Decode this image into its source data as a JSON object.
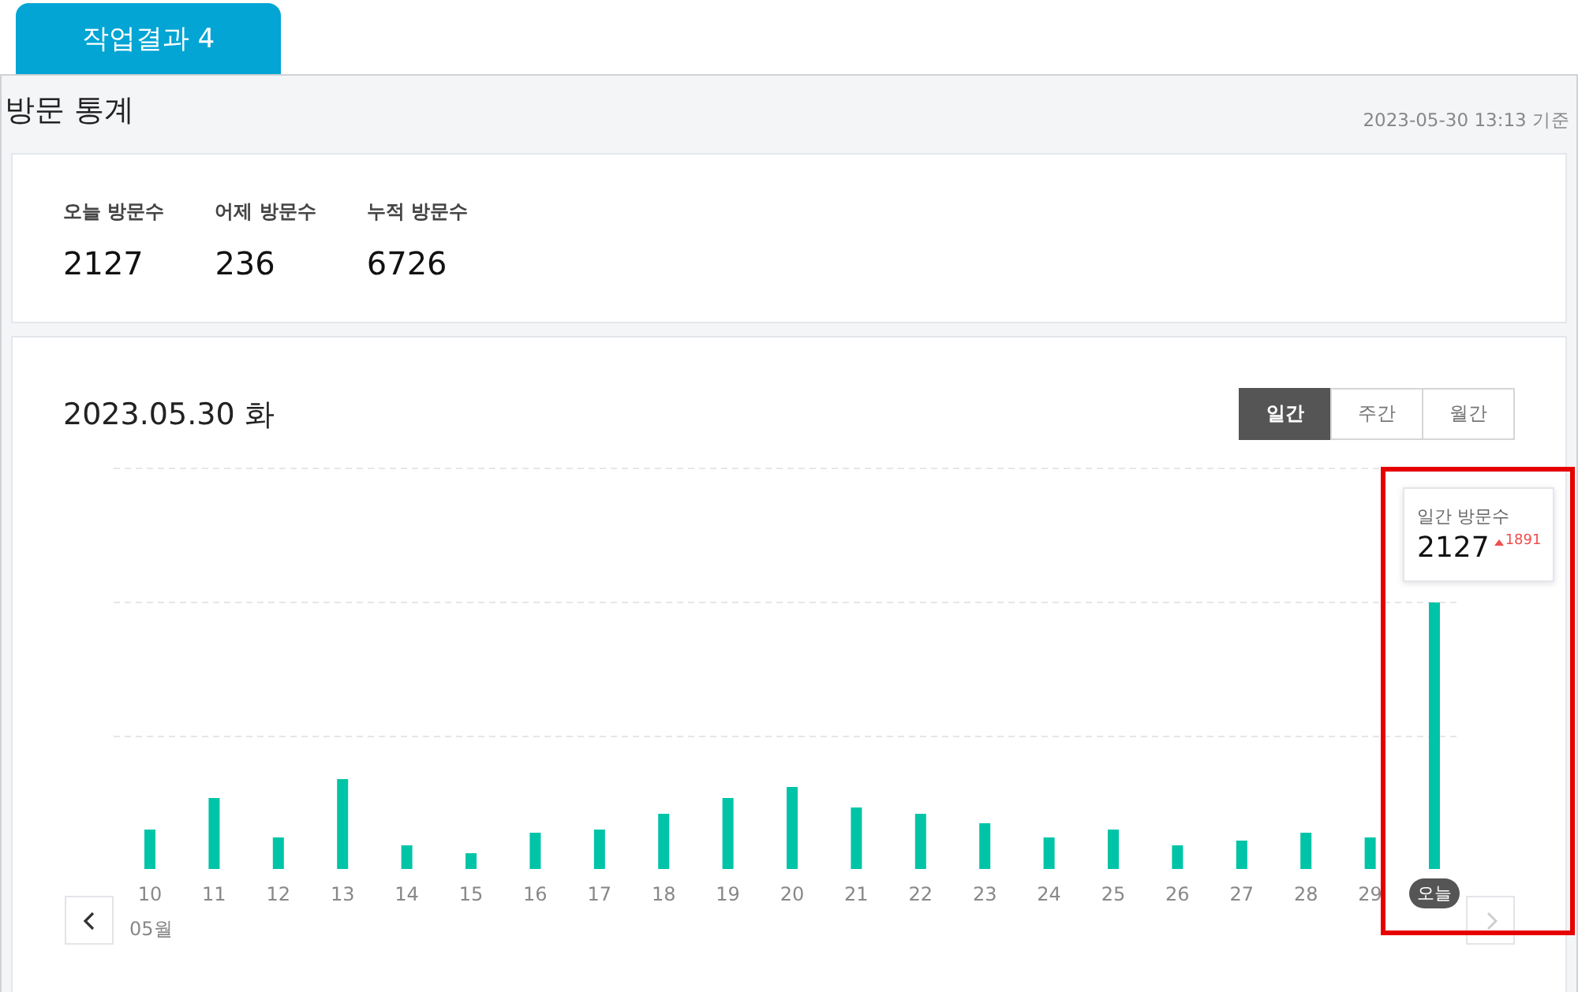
{
  "tab": {
    "label": "작업결과 4"
  },
  "header": {
    "title": "방문 통계",
    "timestamp": "2023-05-30 13:13 기준"
  },
  "stats": [
    {
      "label": "오늘 방문수",
      "value": "2127"
    },
    {
      "label": "어제 방문수",
      "value": "236"
    },
    {
      "label": "누적 방문수",
      "value": "6726"
    }
  ],
  "chart_panel": {
    "date": "2023.05.30 화",
    "periods": [
      {
        "label": "일간",
        "selected": true
      },
      {
        "label": "주간",
        "selected": false
      },
      {
        "label": "월간",
        "selected": false
      }
    ],
    "x_labels": [
      "10",
      "11",
      "12",
      "13",
      "14",
      "15",
      "16",
      "17",
      "18",
      "19",
      "20",
      "21",
      "22",
      "23",
      "24",
      "25",
      "26",
      "27",
      "28",
      "29",
      "오늘"
    ],
    "month_label": "05월",
    "tooltip": {
      "label": "일간 방문수",
      "value": "2127",
      "change": "1891",
      "highlighted": true
    }
  }
}
